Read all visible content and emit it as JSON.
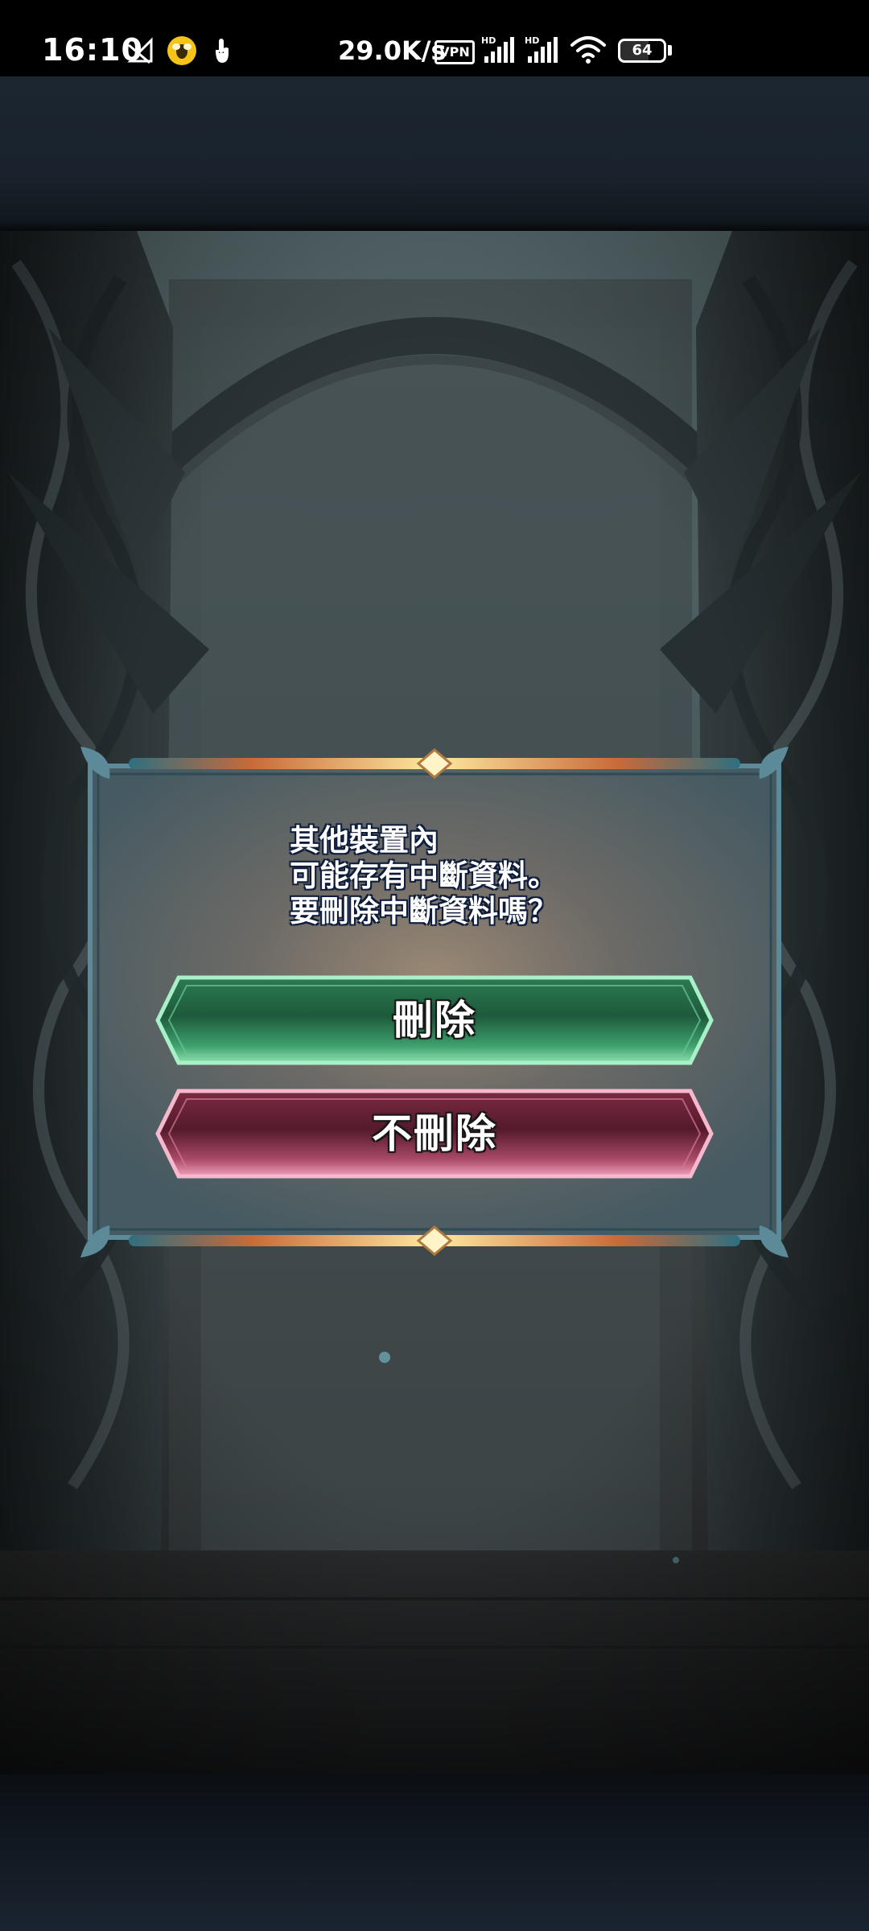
{
  "status_bar": {
    "time": "16:10",
    "network_speed": "29.0K/s",
    "vpn_label": "VPN",
    "battery_level": "64",
    "icons": [
      "no-data-icon",
      "bee-app-icon",
      "touch-icon",
      "signal-hd-icon",
      "signal-hd-icon",
      "wifi-icon",
      "battery-icon"
    ]
  },
  "dialog": {
    "message_lines": [
      "其他裝置內",
      "可能存有中斷資料。",
      "要刪除中斷資料嗎？"
    ],
    "delete_button_label": "刪除",
    "keep_button_label": "不刪除"
  },
  "colors": {
    "delete_button": "#3f9a6a",
    "keep_button": "#9a3c58",
    "dialog_panel": "#4d6068",
    "frame_accent": "#f0c070"
  }
}
